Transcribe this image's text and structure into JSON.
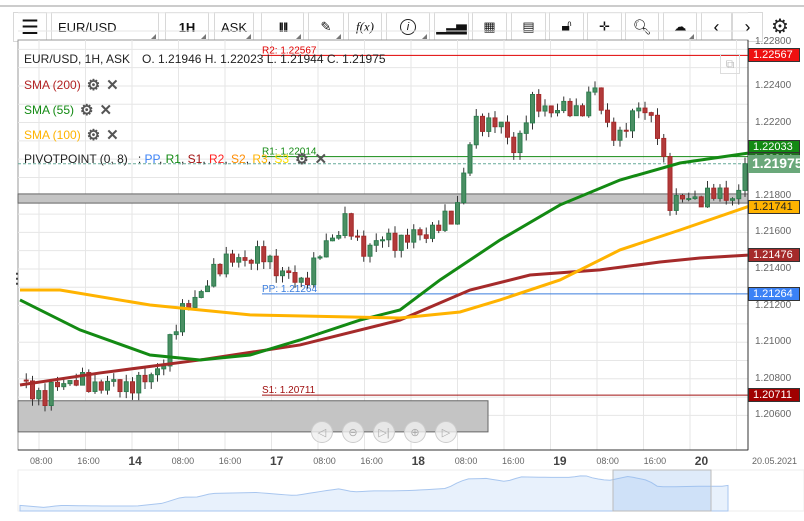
{
  "toolbar": {
    "symbol": "EUR/USD",
    "timeframe": "1H",
    "side": "ASK",
    "fx_label": "f(x)"
  },
  "header": {
    "info": "EUR/USD, 1H, ASK",
    "ohlc": "O. 1.21946 H. 1.22023 L. 1.21944 C. 1.21975"
  },
  "indicators": [
    {
      "label": "SMA (200)",
      "color": "#b22222"
    },
    {
      "label": "SMA (55)",
      "color": "#138a13"
    },
    {
      "label": "SMA (100)",
      "color": "#ffb300"
    }
  ],
  "pivot": {
    "label": "PIVOTPOINT (0, 8)",
    "sep": ":",
    "items": [
      {
        "t": "PP",
        "c": "#3b82f6"
      },
      {
        "t": "R1",
        "c": "#138a13"
      },
      {
        "t": "S1",
        "c": "#a01010"
      },
      {
        "t": "R2",
        "c": "#ff2020"
      },
      {
        "t": "S2",
        "c": "#ff8c00"
      },
      {
        "t": "R3",
        "c": "#ffb300"
      },
      {
        "t": "S3",
        "c": "#ffe000"
      }
    ]
  },
  "pivot_lines": [
    {
      "label": "R2: 1.22567",
      "price": 1.22567,
      "color": "#e00000"
    },
    {
      "label": "R1: 1.22014",
      "price": 1.22014,
      "color": "#138a13"
    },
    {
      "label": "PP: 1.21264",
      "price": 1.21264,
      "color": "#3b7ddd"
    },
    {
      "label": "S1: 1.20711",
      "price": 1.20711,
      "color": "#a01010"
    }
  ],
  "price_axis": {
    "ticks": [
      "1.22800",
      "1.22400",
      "1.22200",
      "1.21800",
      "1.21600",
      "1.21400",
      "1.21200",
      "1.21000",
      "1.20800",
      "1.20600"
    ],
    "ylim": [
      1.20411,
      1.22651
    ]
  },
  "price_tags": [
    {
      "label": "1.22567",
      "price": 1.22567,
      "bg": "#ee1111",
      "fg": "#fff"
    },
    {
      "label": "1.22033",
      "price": 1.22033,
      "bg": "#138a13",
      "fg": "#fff"
    },
    {
      "label": "1.22014",
      "price": 1.22014,
      "bg": "#1f6e1f",
      "fg": "#fff"
    },
    {
      "label": "1.21975",
      "price": 1.21975,
      "bg": "#6aa87a",
      "fg": "#fff",
      "big": true
    },
    {
      "label": "1.21741",
      "price": 1.21741,
      "bg": "#ffb300",
      "fg": "#222"
    },
    {
      "label": "1.21476",
      "price": 1.21476,
      "bg": "#a52a2a",
      "fg": "#fff"
    },
    {
      "label": "1.21264",
      "price": 1.21264,
      "bg": "#3b82f6",
      "fg": "#fff"
    },
    {
      "label": "1.20711",
      "price": 1.20711,
      "bg": "#a00000",
      "fg": "#fff"
    }
  ],
  "time_axis": [
    {
      "t": "08:00"
    },
    {
      "t": "16:00"
    },
    {
      "t": "14",
      "b": true
    },
    {
      "t": "08:00"
    },
    {
      "t": "16:00"
    },
    {
      "t": "17",
      "b": true
    },
    {
      "t": "08:00"
    },
    {
      "t": "16:00"
    },
    {
      "t": "18",
      "b": true
    },
    {
      "t": "08:00"
    },
    {
      "t": "16:00"
    },
    {
      "t": "19",
      "b": true
    },
    {
      "t": "08:00"
    },
    {
      "t": "16:00"
    },
    {
      "t": "20",
      "b": true
    },
    {
      "t": "20.05.2021"
    }
  ],
  "chart_data": {
    "type": "candlestick",
    "close_anchors": [
      [
        0,
        1.20793
      ],
      [
        4,
        1.20684
      ],
      [
        6.4,
        1.20793
      ],
      [
        12.8,
        1.20766
      ],
      [
        19.2,
        1.20766
      ],
      [
        23.2,
        1.20903
      ],
      [
        26.4,
        1.21231
      ],
      [
        28.8,
        1.21231
      ],
      [
        31.2,
        1.21422
      ],
      [
        38.4,
        1.21477
      ],
      [
        41.6,
        1.21395
      ],
      [
        44.8,
        1.21313
      ],
      [
        49.6,
        1.21558
      ],
      [
        52,
        1.21668
      ],
      [
        54.4,
        1.21504
      ],
      [
        57.6,
        1.21558
      ],
      [
        60.8,
        1.21558
      ],
      [
        64,
        1.21586
      ],
      [
        67.2,
        1.2164
      ],
      [
        69.6,
        1.21695
      ],
      [
        71.2,
        1.21968
      ],
      [
        72.8,
        1.22187
      ],
      [
        76,
        1.22214
      ],
      [
        79.2,
        1.2205
      ],
      [
        81.6,
        1.22296
      ],
      [
        86.4,
        1.22269
      ],
      [
        89.6,
        1.22269
      ],
      [
        92,
        1.22378
      ],
      [
        93.6,
        1.22214
      ],
      [
        96,
        1.22105
      ],
      [
        99.2,
        1.22323
      ],
      [
        102.4,
        1.22105
      ],
      [
        104,
        1.21777
      ],
      [
        107.2,
        1.21777
      ],
      [
        110.4,
        1.21804
      ],
      [
        115.2,
        1.21804
      ],
      [
        116,
        1.21975
      ]
    ],
    "sma200": [
      [
        0,
        1.20766
      ],
      [
        12.8,
        1.20832
      ],
      [
        28.8,
        1.20903
      ],
      [
        44.8,
        1.20985
      ],
      [
        60.8,
        1.21121
      ],
      [
        72,
        1.21285
      ],
      [
        81.6,
        1.21367
      ],
      [
        92.8,
        1.21395
      ],
      [
        102.4,
        1.21438
      ],
      [
        108.8,
        1.2146
      ],
      [
        116.5,
        1.21476
      ]
    ],
    "sma55": [
      [
        0,
        1.21231
      ],
      [
        9.6,
        1.21067
      ],
      [
        20.8,
        1.2093
      ],
      [
        28.8,
        1.20903
      ],
      [
        36.8,
        1.2093
      ],
      [
        44.8,
        1.21012
      ],
      [
        54.4,
        1.21121
      ],
      [
        60.8,
        1.21176
      ],
      [
        67.2,
        1.2134
      ],
      [
        76.8,
        1.21558
      ],
      [
        86.4,
        1.2175
      ],
      [
        96,
        1.21886
      ],
      [
        105.6,
        1.21979
      ],
      [
        116.5,
        1.22033
      ]
    ],
    "sma100": [
      [
        0,
        1.21285
      ],
      [
        6.4,
        1.21285
      ],
      [
        20.8,
        1.21203
      ],
      [
        36.8,
        1.21149
      ],
      [
        60.8,
        1.21132
      ],
      [
        70.4,
        1.21165
      ],
      [
        76.8,
        1.21231
      ],
      [
        86.4,
        1.2134
      ],
      [
        96,
        1.21504
      ],
      [
        105.6,
        1.21613
      ],
      [
        116.5,
        1.21741
      ]
    ],
    "zones": [
      [
        1.2176,
        1.2181
      ],
      [
        1.2051,
        1.2068
      ]
    ]
  }
}
